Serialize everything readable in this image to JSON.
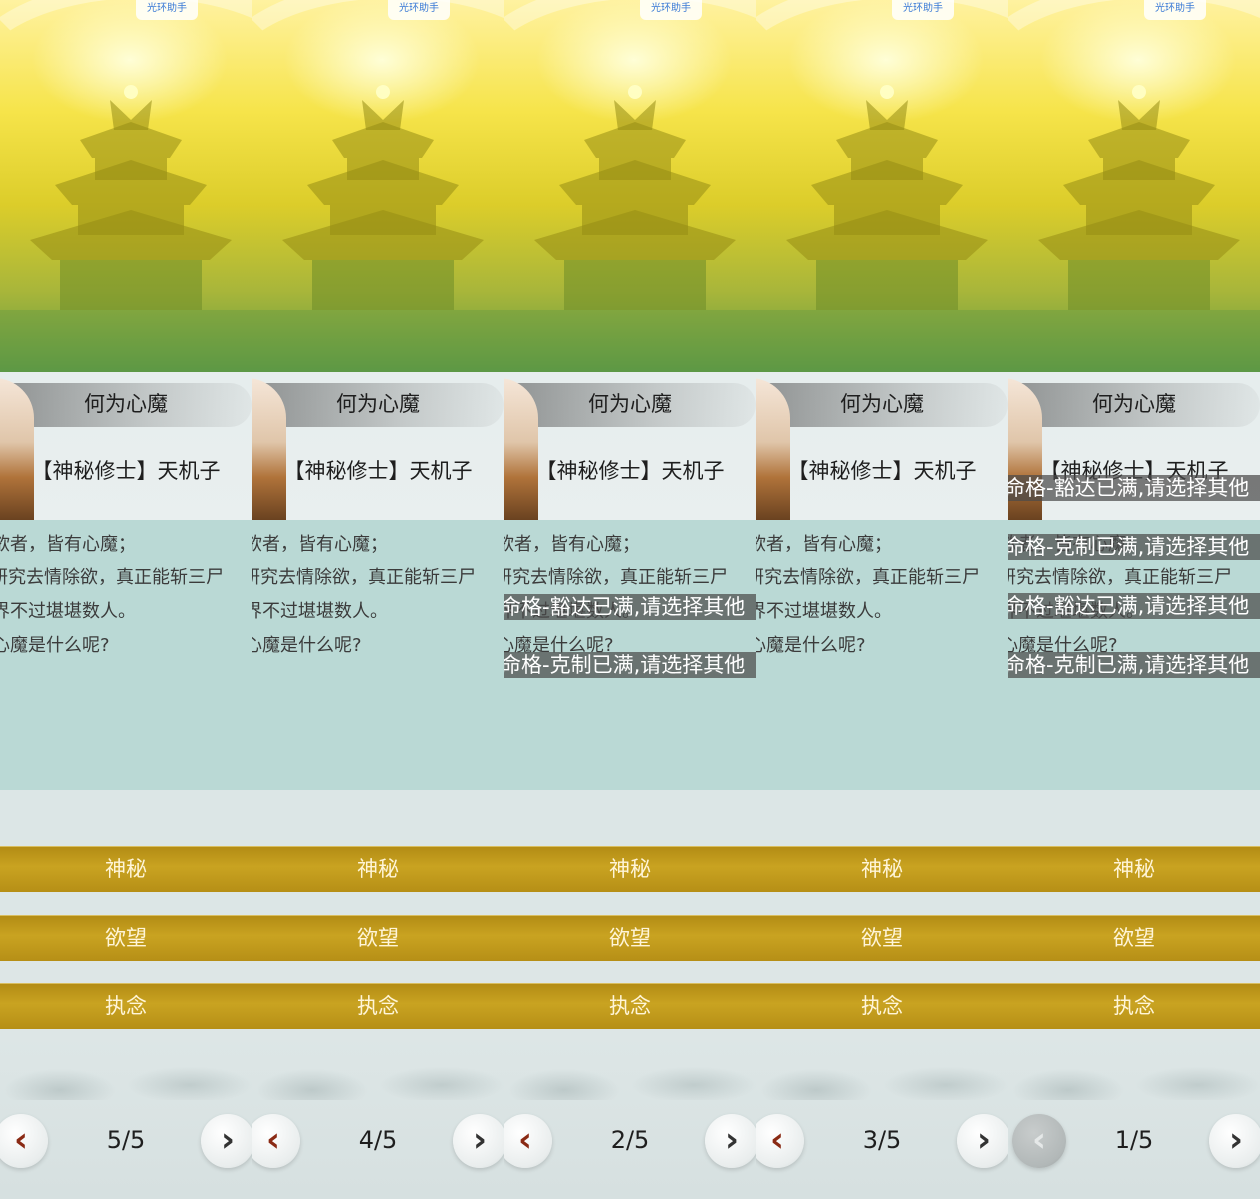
{
  "brand_tag": "光环助手",
  "dialog": {
    "title": "何为心魔",
    "speaker": "【神秘修士】天机子",
    "text_lines": [
      "欲者，皆有心魔；",
      "研究去情除欲，真正能斩三尸",
      "界不过堪堪数人。",
      "心魔是什么呢?"
    ]
  },
  "choices": [
    "神秘",
    "欲望",
    "执念"
  ],
  "panels": [
    {
      "page": "5/5",
      "prev_disabled": false
    },
    {
      "page": "4/5",
      "prev_disabled": false
    },
    {
      "page": "2/5",
      "prev_disabled": false
    },
    {
      "page": "3/5",
      "prev_disabled": false
    },
    {
      "page": "1/5",
      "prev_disabled": true
    }
  ],
  "toasts": {
    "haoda_full": "命格-豁达已满,请选择其他",
    "kezhi_full": "命格-克制已满,请选择其他"
  },
  "nav": {
    "prev_glyph": "‹",
    "next_glyph": "›"
  }
}
